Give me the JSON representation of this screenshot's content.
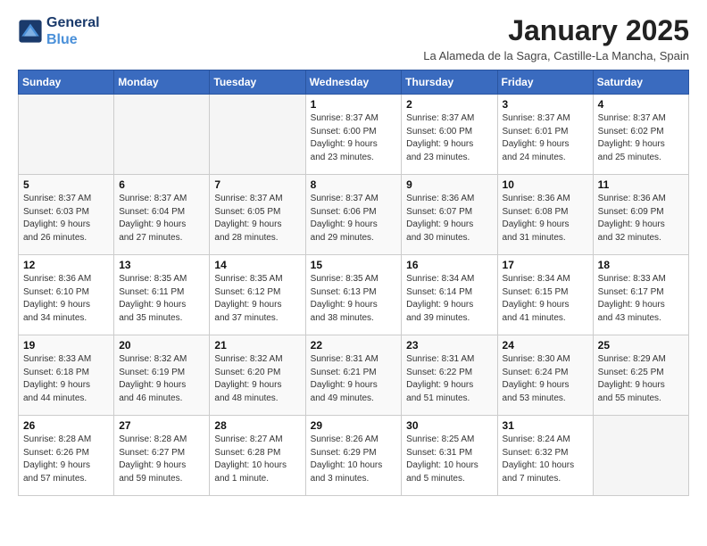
{
  "header": {
    "logo_line1": "General",
    "logo_line2": "Blue",
    "month": "January 2025",
    "location": "La Alameda de la Sagra, Castille-La Mancha, Spain"
  },
  "days_of_week": [
    "Sunday",
    "Monday",
    "Tuesday",
    "Wednesday",
    "Thursday",
    "Friday",
    "Saturday"
  ],
  "weeks": [
    [
      {
        "day": "",
        "info": ""
      },
      {
        "day": "",
        "info": ""
      },
      {
        "day": "",
        "info": ""
      },
      {
        "day": "1",
        "info": "Sunrise: 8:37 AM\nSunset: 6:00 PM\nDaylight: 9 hours\nand 23 minutes."
      },
      {
        "day": "2",
        "info": "Sunrise: 8:37 AM\nSunset: 6:00 PM\nDaylight: 9 hours\nand 23 minutes."
      },
      {
        "day": "3",
        "info": "Sunrise: 8:37 AM\nSunset: 6:01 PM\nDaylight: 9 hours\nand 24 minutes."
      },
      {
        "day": "4",
        "info": "Sunrise: 8:37 AM\nSunset: 6:02 PM\nDaylight: 9 hours\nand 25 minutes."
      }
    ],
    [
      {
        "day": "5",
        "info": "Sunrise: 8:37 AM\nSunset: 6:03 PM\nDaylight: 9 hours\nand 26 minutes."
      },
      {
        "day": "6",
        "info": "Sunrise: 8:37 AM\nSunset: 6:04 PM\nDaylight: 9 hours\nand 27 minutes."
      },
      {
        "day": "7",
        "info": "Sunrise: 8:37 AM\nSunset: 6:05 PM\nDaylight: 9 hours\nand 28 minutes."
      },
      {
        "day": "8",
        "info": "Sunrise: 8:37 AM\nSunset: 6:06 PM\nDaylight: 9 hours\nand 29 minutes."
      },
      {
        "day": "9",
        "info": "Sunrise: 8:36 AM\nSunset: 6:07 PM\nDaylight: 9 hours\nand 30 minutes."
      },
      {
        "day": "10",
        "info": "Sunrise: 8:36 AM\nSunset: 6:08 PM\nDaylight: 9 hours\nand 31 minutes."
      },
      {
        "day": "11",
        "info": "Sunrise: 8:36 AM\nSunset: 6:09 PM\nDaylight: 9 hours\nand 32 minutes."
      }
    ],
    [
      {
        "day": "12",
        "info": "Sunrise: 8:36 AM\nSunset: 6:10 PM\nDaylight: 9 hours\nand 34 minutes."
      },
      {
        "day": "13",
        "info": "Sunrise: 8:35 AM\nSunset: 6:11 PM\nDaylight: 9 hours\nand 35 minutes."
      },
      {
        "day": "14",
        "info": "Sunrise: 8:35 AM\nSunset: 6:12 PM\nDaylight: 9 hours\nand 37 minutes."
      },
      {
        "day": "15",
        "info": "Sunrise: 8:35 AM\nSunset: 6:13 PM\nDaylight: 9 hours\nand 38 minutes."
      },
      {
        "day": "16",
        "info": "Sunrise: 8:34 AM\nSunset: 6:14 PM\nDaylight: 9 hours\nand 39 minutes."
      },
      {
        "day": "17",
        "info": "Sunrise: 8:34 AM\nSunset: 6:15 PM\nDaylight: 9 hours\nand 41 minutes."
      },
      {
        "day": "18",
        "info": "Sunrise: 8:33 AM\nSunset: 6:17 PM\nDaylight: 9 hours\nand 43 minutes."
      }
    ],
    [
      {
        "day": "19",
        "info": "Sunrise: 8:33 AM\nSunset: 6:18 PM\nDaylight: 9 hours\nand 44 minutes."
      },
      {
        "day": "20",
        "info": "Sunrise: 8:32 AM\nSunset: 6:19 PM\nDaylight: 9 hours\nand 46 minutes."
      },
      {
        "day": "21",
        "info": "Sunrise: 8:32 AM\nSunset: 6:20 PM\nDaylight: 9 hours\nand 48 minutes."
      },
      {
        "day": "22",
        "info": "Sunrise: 8:31 AM\nSunset: 6:21 PM\nDaylight: 9 hours\nand 49 minutes."
      },
      {
        "day": "23",
        "info": "Sunrise: 8:31 AM\nSunset: 6:22 PM\nDaylight: 9 hours\nand 51 minutes."
      },
      {
        "day": "24",
        "info": "Sunrise: 8:30 AM\nSunset: 6:24 PM\nDaylight: 9 hours\nand 53 minutes."
      },
      {
        "day": "25",
        "info": "Sunrise: 8:29 AM\nSunset: 6:25 PM\nDaylight: 9 hours\nand 55 minutes."
      }
    ],
    [
      {
        "day": "26",
        "info": "Sunrise: 8:28 AM\nSunset: 6:26 PM\nDaylight: 9 hours\nand 57 minutes."
      },
      {
        "day": "27",
        "info": "Sunrise: 8:28 AM\nSunset: 6:27 PM\nDaylight: 9 hours\nand 59 minutes."
      },
      {
        "day": "28",
        "info": "Sunrise: 8:27 AM\nSunset: 6:28 PM\nDaylight: 10 hours\nand 1 minute."
      },
      {
        "day": "29",
        "info": "Sunrise: 8:26 AM\nSunset: 6:29 PM\nDaylight: 10 hours\nand 3 minutes."
      },
      {
        "day": "30",
        "info": "Sunrise: 8:25 AM\nSunset: 6:31 PM\nDaylight: 10 hours\nand 5 minutes."
      },
      {
        "day": "31",
        "info": "Sunrise: 8:24 AM\nSunset: 6:32 PM\nDaylight: 10 hours\nand 7 minutes."
      },
      {
        "day": "",
        "info": ""
      }
    ]
  ]
}
